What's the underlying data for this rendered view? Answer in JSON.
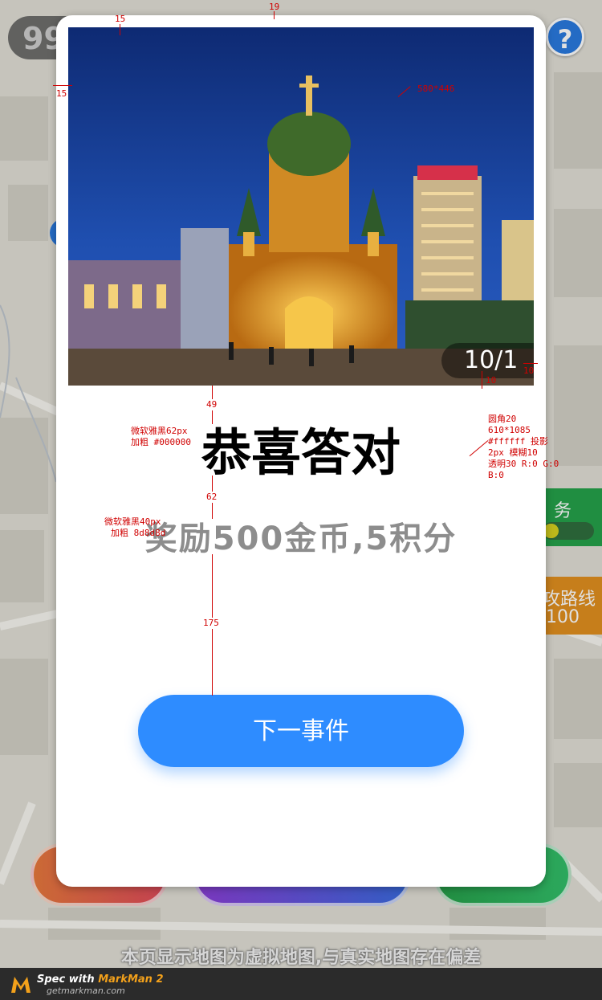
{
  "map": {
    "score_text": "99",
    "help_icon": "question-mark-icon",
    "task_label": "务",
    "task_progress": 0.3,
    "route_label": "攻路线",
    "route_value": "100",
    "disclaimer": "本页显示地图为虚拟地图,与真实地图存在偏差"
  },
  "modal": {
    "page_indicator": "10/1",
    "title": "恭喜答对",
    "reward": "奖励500金币,5积分",
    "next_button": "下一事件",
    "photo_alt": "church-night-photo"
  },
  "annotations": {
    "top_spacing": "15",
    "top_left_spacing": "19",
    "left_spacing": "15",
    "image_size": "580*446",
    "badge_right": "10",
    "badge_bottom": "10",
    "gap_title": "49",
    "gap_subtitle": "62",
    "gap_button": "175",
    "title_spec_1": "微软雅黑62px",
    "title_spec_2": "加粗 #000000",
    "sub_spec_1": "微软雅黑40px",
    "sub_spec_2": "加粗 8d8d8d",
    "card_spec": [
      "圆角20",
      "610*1085",
      "#ffffff 投影",
      "2px 模糊10",
      "透明30 R:0 G:0",
      "B:0"
    ]
  },
  "footer": {
    "spec_with": "Spec with ",
    "brand": "MarkMan 2",
    "site": "getmarkman.com"
  },
  "colors": {
    "primary_button": "#2e8cff",
    "title": "#000000",
    "subtitle": "#8d8d8d",
    "annotation": "#d00000"
  }
}
